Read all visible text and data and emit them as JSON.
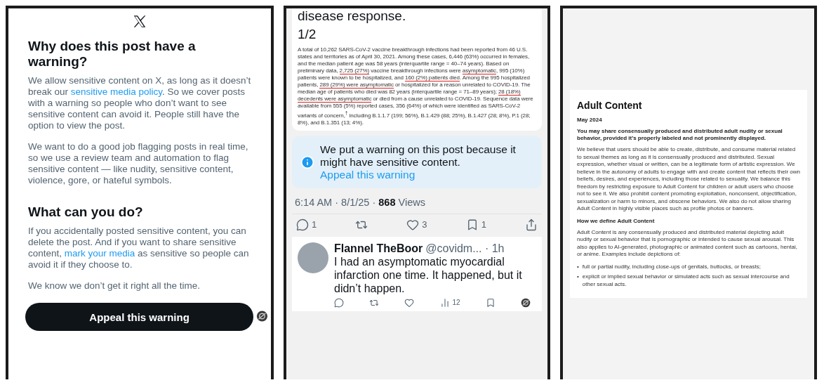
{
  "warning_explainer": {
    "heading": "Why does this post have a warning?",
    "paragraphs": [
      {
        "parts": [
          {
            "kind": "text",
            "text": "We allow sensitive content on X, as long as it doesn’t break our "
          },
          {
            "kind": "link",
            "text": "sensitive media policy"
          },
          {
            "kind": "text",
            "text": ". So we cover posts with a warning so people who don’t want to see sensitive content can avoid it. People still have the option to view the post."
          }
        ]
      },
      {
        "parts": [
          {
            "kind": "text",
            "text": "We want to do a good job flagging posts in real time, so we use a review team and automation to flag sensitive content — like nudity, sensitive content, violence, gore, or hateful symbols."
          }
        ]
      }
    ],
    "subheading": "What can you do?",
    "paragraphs_2": [
      {
        "parts": [
          {
            "kind": "text",
            "text": "If you accidentally posted sensitive content, you can delete the post. And if you want to share sensitive content, "
          },
          {
            "kind": "link",
            "text": "mark your media"
          },
          {
            "kind": "text",
            "text": " as sensitive so people can avoid it if they choose to."
          }
        ]
      },
      {
        "parts": [
          {
            "kind": "text",
            "text": "We know we don’t get it right all the time."
          }
        ]
      }
    ],
    "button": "Appeal this warning"
  },
  "post": {
    "cut_text": "disease response.",
    "counter": "1/2",
    "excerpt": [
      {
        "kind": "plain",
        "text": "A total of 10,262 SARS-CoV-2 vaccine breakthrough infections had been reported from 46 U.S. states and territories as of April 30, 2021. Among these cases, 6,446 (63%) occurred in females, and the median patient age was 58 years (interquartile range = 40–74 years). Based on preliminary data, "
      },
      {
        "kind": "underlined",
        "text": "2,725 (27%)"
      },
      {
        "kind": "plain",
        "text": " vaccine breakthrough infections were "
      },
      {
        "kind": "underlined",
        "text": "asymptomatic"
      },
      {
        "kind": "plain",
        "text": ", 995 (10%) patients were known to be hospitalized, and "
      },
      {
        "kind": "underlined",
        "text": "160 (2%) patients died"
      },
      {
        "kind": "plain",
        "text": ". Among the 995 hospitalized patients, "
      },
      {
        "kind": "underlined",
        "text": "289 (29%) were asymptomatic"
      },
      {
        "kind": "plain",
        "text": " or hospitalized for a reason unrelated to COVID-19. The median age of patients who died was 82 years (interquartile range = 71–89 years); "
      },
      {
        "kind": "underlined",
        "text": "28 (18%) decedents were asymptomatic"
      },
      {
        "kind": "plain",
        "text": " or died from a cause unrelated to COVID-19. Sequence data were available from 555 (5%) reported cases, 356 (64%) of which were identified as SARS-CoV-2 variants of concern,$^{†}$ including B.1.1.7 (199; 56%), B.1.429 (88; 25%), B.1.427 (28; 8%), P.1 (28; 8%), and B.1.351 (13; 4%)."
      }
    ],
    "notice": [
      {
        "kind": "text",
        "text": "We put a warning on this post because it might have sensitive content. "
      },
      {
        "kind": "link",
        "text": "Appeal this warning"
      }
    ],
    "time": "6:14 AM · 8/1/25 · ",
    "views_count": "868",
    "views_label": " Views",
    "actions": [
      {
        "kind": "reply",
        "count": "1"
      },
      {
        "kind": "repost"
      },
      {
        "kind": "like",
        "count": "3"
      },
      {
        "kind": "bookmark",
        "count": "1"
      },
      {
        "kind": "share"
      }
    ],
    "reply": {
      "name": "Flannel TheBoor",
      "handle": "@covidm... · 1h",
      "text": "I had an asymptomatic myocardial infarction one time. It happened, but it didn’t happen.",
      "actions": [
        {
          "kind": "reply"
        },
        {
          "kind": "repost"
        },
        {
          "kind": "like"
        },
        {
          "kind": "views",
          "count": "12"
        },
        {
          "kind": "bookmark"
        },
        {
          "kind": "grok"
        }
      ]
    }
  },
  "policy": {
    "title": "Adult Content",
    "date": "May 2024",
    "lead": "You may share consensually produced and distributed adult nudity or sexual behavior, provided it’s properly labeled and not prominently displayed.",
    "body": "We believe that users should be able to create, distribute, and consume material related to sexual themes as long as it is consensually produced and distributed. Sexual expression, whether visual or written, can be a legitimate form of artistic expression. We believe in the autonomy of adults to engage with and create content that reflects their own beliefs, desires, and experiences, including those related to sexuality. We balance this freedom by restricting exposure to Adult Content for children or adult users who choose not to see it. We also prohibit content promoting exploitation, nonconsent, objectification, sexualization or harm to minors, and obscene behaviors. We also do not allow sharing Adult Content in highly visible places such as profile photos or banners.",
    "section": "How we define Adult Content",
    "section_body": "Adult Content is any consensually produced and distributed material depicting adult nudity or sexual behavior that is pornographic or intended to cause sexual arousal. This also applies to AI-generated, photographic or animated content such as cartoons, hentai, or anime. Examples include depictions of:",
    "bullets": [
      {
        "marker": "•",
        "text": "full or partial nudity, including close-ups of genitals, buttocks, or breasts;"
      },
      {
        "marker": "•",
        "text": "explicit or implied sexual behavior or simulated acts such as sexual intercourse and other sexual acts."
      }
    ]
  }
}
